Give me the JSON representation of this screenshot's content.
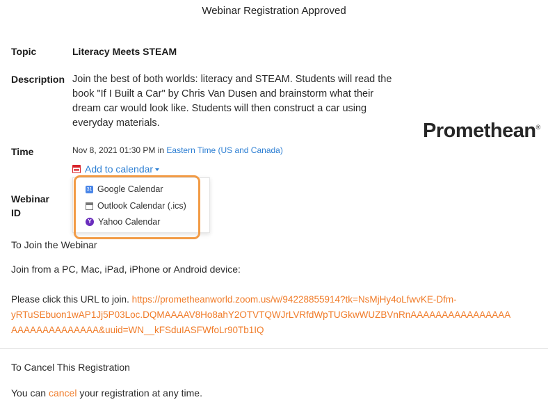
{
  "page_title": "Webinar Registration Approved",
  "topic": {
    "label": "Topic",
    "value": "Literacy Meets STEAM"
  },
  "description": {
    "label": "Description",
    "lines": [
      "Join the best of both worlds: literacy and STEAM. Students will read the",
      "book \"If I Built a Car\" by Chris Van Dusen and brainstorm what their",
      "dream car would look like. Students will then construct a car using",
      "everyday materials."
    ]
  },
  "time": {
    "label": "Time",
    "datetime": "Nov 8, 2021 01:30 PM in ",
    "timezone": "Eastern Time (US and Canada)",
    "add_to_calendar": "Add to calendar"
  },
  "calendar_menu": {
    "google": "Google Calendar",
    "outlook": "Outlook Calendar (.ics)",
    "yahoo": "Yahoo Calendar",
    "google_glyph": "31",
    "yahoo_glyph": "Y"
  },
  "webinar_id": {
    "label_line1": "Webinar",
    "label_line2": "ID"
  },
  "logo": {
    "text": "Promethean",
    "mark": "®"
  },
  "join": {
    "heading": "To Join the Webinar",
    "devices": "Join from a PC, Mac, iPad, iPhone or Android device:",
    "prompt": "Please click this URL to join. ",
    "url_line1": "https://prometheanworld.zoom.us/w/94228855914?tk=NsMjHy4oLfwvKE-Dfm-",
    "url_line2": "yRTuSEbuon1wAP1Jj5P03Loc.DQMAAAAV8Ho8ahY2OTVTQWJrLVRfdWpTUGkwWUZBVnRnAAAAAAAAAAAAAAAA",
    "url_line3": "AAAAAAAAAAAAAA&uuid=WN__kFSduIASFWfoLr90Tb1IQ"
  },
  "cancel": {
    "heading": "To Cancel This Registration",
    "prefix": "You can ",
    "link": "cancel",
    "suffix": " your registration at any time."
  },
  "colors": {
    "link_blue": "#2d7fd3",
    "link_orange": "#f07c2a",
    "highlight": "#f29b46"
  }
}
